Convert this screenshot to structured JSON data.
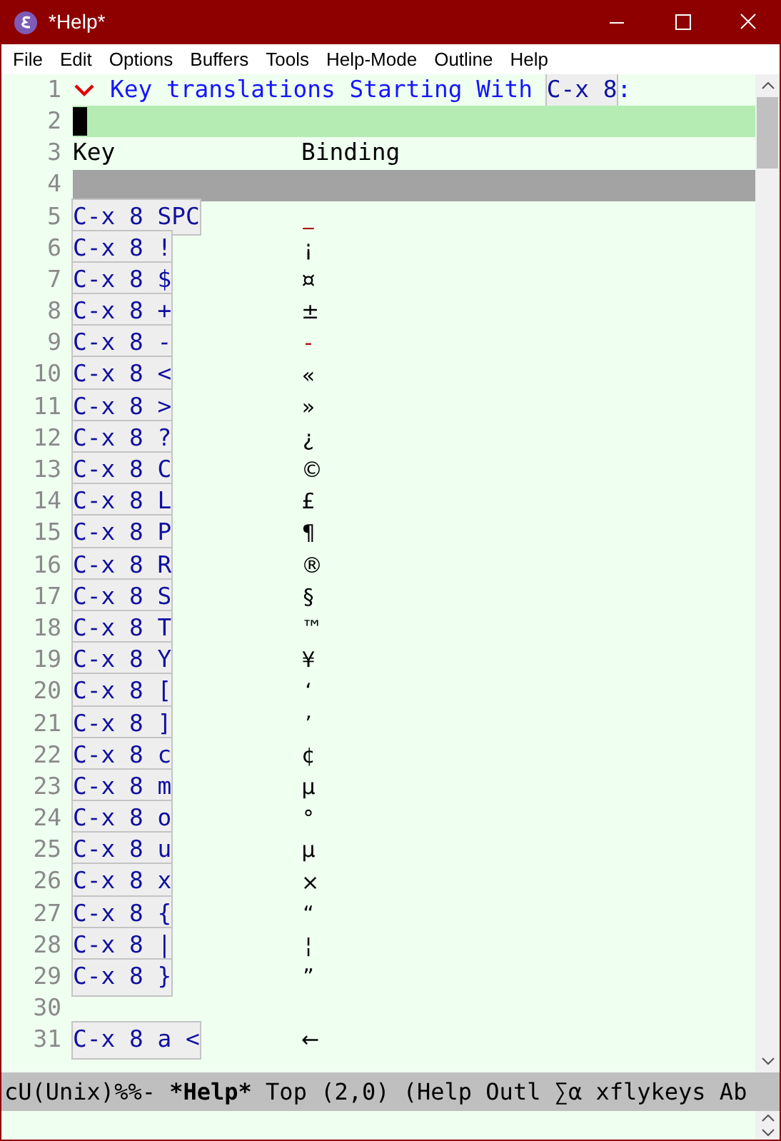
{
  "window": {
    "title": "*Help*"
  },
  "menu": [
    "File",
    "Edit",
    "Options",
    "Buffers",
    "Tools",
    "Help-Mode",
    "Outline",
    "Help"
  ],
  "lines": [
    {
      "number": "1",
      "kind": "heading",
      "text": "Key translations Starting With ",
      "key": "C-x 8",
      "suffix": ":",
      "expanded": true
    },
    {
      "number": "2",
      "kind": "cursor"
    },
    {
      "number": "3",
      "kind": "header",
      "key": "Key",
      "binding": "Binding"
    },
    {
      "number": "4",
      "kind": "rule"
    },
    {
      "number": "5",
      "kind": "entry",
      "key": "C-x 8 SPC",
      "binding": "_",
      "special": true
    },
    {
      "number": "6",
      "kind": "entry",
      "key": "C-x 8 !",
      "binding": "¡",
      "special": false
    },
    {
      "number": "7",
      "kind": "entry",
      "key": "C-x 8 $",
      "binding": "¤",
      "special": false
    },
    {
      "number": "8",
      "kind": "entry",
      "key": "C-x 8 +",
      "binding": "±",
      "special": false
    },
    {
      "number": "9",
      "kind": "entry",
      "key": "C-x 8 -",
      "binding": "-",
      "special": true
    },
    {
      "number": "10",
      "kind": "entry",
      "key": "C-x 8 <",
      "binding": "«",
      "special": false
    },
    {
      "number": "11",
      "kind": "entry",
      "key": "C-x 8 >",
      "binding": "»",
      "special": false
    },
    {
      "number": "12",
      "kind": "entry",
      "key": "C-x 8 ?",
      "binding": "¿",
      "special": false
    },
    {
      "number": "13",
      "kind": "entry",
      "key": "C-x 8 C",
      "binding": "©",
      "special": false
    },
    {
      "number": "14",
      "kind": "entry",
      "key": "C-x 8 L",
      "binding": "£",
      "special": false
    },
    {
      "number": "15",
      "kind": "entry",
      "key": "C-x 8 P",
      "binding": "¶",
      "special": false
    },
    {
      "number": "16",
      "kind": "entry",
      "key": "C-x 8 R",
      "binding": "®",
      "special": false
    },
    {
      "number": "17",
      "kind": "entry",
      "key": "C-x 8 S",
      "binding": "§",
      "special": false
    },
    {
      "number": "18",
      "kind": "entry",
      "key": "C-x 8 T",
      "binding": "™",
      "special": false
    },
    {
      "number": "19",
      "kind": "entry",
      "key": "C-x 8 Y",
      "binding": "¥",
      "special": false
    },
    {
      "number": "20",
      "kind": "entry",
      "key": "C-x 8 [",
      "binding": "‘",
      "special": false
    },
    {
      "number": "21",
      "kind": "entry",
      "key": "C-x 8 ]",
      "binding": "’",
      "special": false
    },
    {
      "number": "22",
      "kind": "entry",
      "key": "C-x 8 c",
      "binding": "¢",
      "special": false
    },
    {
      "number": "23",
      "kind": "entry",
      "key": "C-x 8 m",
      "binding": "µ",
      "special": false
    },
    {
      "number": "24",
      "kind": "entry",
      "key": "C-x 8 o",
      "binding": "°",
      "special": false
    },
    {
      "number": "25",
      "kind": "entry",
      "key": "C-x 8 u",
      "binding": "µ",
      "special": false
    },
    {
      "number": "26",
      "kind": "entry",
      "key": "C-x 8 x",
      "binding": "×",
      "special": false
    },
    {
      "number": "27",
      "kind": "entry",
      "key": "C-x 8 {",
      "binding": "“",
      "special": false
    },
    {
      "number": "28",
      "kind": "entry",
      "key": "C-x 8 |",
      "binding": "¦",
      "special": false
    },
    {
      "number": "29",
      "kind": "entry",
      "key": "C-x 8 }",
      "binding": "”",
      "special": false
    },
    {
      "number": "30",
      "kind": "blank"
    },
    {
      "number": "31",
      "kind": "entry",
      "key": "C-x 8 a <",
      "binding": "←",
      "special": false
    }
  ],
  "mode_line": {
    "prefix": "cU(Unix)%%-",
    "buffer": "*Help*",
    "rest": "Top (2,0) (Help Outl ∑α xflykeys Ab"
  }
}
